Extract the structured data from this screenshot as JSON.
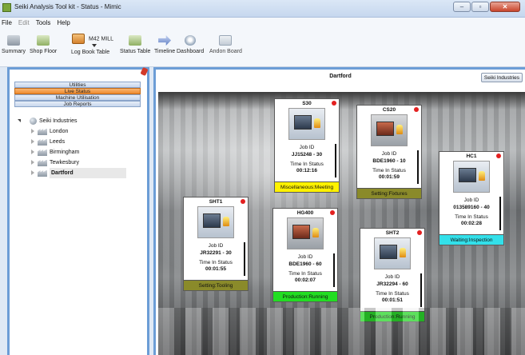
{
  "window": {
    "title": "Seiki Analysis Tool kit - Status - Mimic"
  },
  "menu": [
    "File",
    "Edit",
    "Tools",
    "Help"
  ],
  "toolbar": {
    "summary": "Summary",
    "shop_floor": "Shop Floor",
    "log_book_table": "Log Book Table",
    "machine_selector": "M42 MILL",
    "status_table": "Status Table",
    "timeline": "Timeline",
    "dashboard": "Dashboard",
    "andon_board": "Andon Board"
  },
  "nav": {
    "utilities": "Utilities",
    "live_status": "Live Status",
    "machine_utilisation": "Machine Utilisation",
    "job_reports": "Job Reports"
  },
  "tree": {
    "root": "Seiki Industries",
    "sites": [
      "London",
      "Leeds",
      "Birmingham",
      "Tewkesbury",
      "Dartford"
    ],
    "selected": "Dartford"
  },
  "view": {
    "site_title": "Dartford",
    "company_button": "Seiki Industries"
  },
  "labels": {
    "job_id": "Job ID",
    "time_in_status": "Time In Status"
  },
  "machines": [
    {
      "name": "S30",
      "job_id": "JJ15248 - 30",
      "time": "00:12:16",
      "status": "Miscellaneous:Meeting",
      "status_color": "#fff200"
    },
    {
      "name": "CS20",
      "job_id": "BDE1960 - 10",
      "time": "00:01:59",
      "status": "Setting:Fixtures",
      "status_color": "#8a8a2a"
    },
    {
      "name": "HC1",
      "job_id": "013589160 - 40",
      "time": "00:02:28",
      "status": "Waiting:Inspection",
      "status_color": "#33e0ea"
    },
    {
      "name": "SHT1",
      "job_id": "JR32291 - 30",
      "time": "00:01:55",
      "status": "Setting:Tooling",
      "status_color": "#8a8a2a"
    },
    {
      "name": "HG400",
      "job_id": "BDE1960 - 60",
      "time": "00:02:07",
      "status": "Production:Running",
      "status_color": "#22dd22"
    },
    {
      "name": "SHT2",
      "job_id": "JR32294 - 60",
      "time": "00:01:51",
      "status": "Production:Running",
      "status_color": "#22dd22"
    }
  ],
  "colors": {
    "pane_border": "#6c9dd6",
    "live_status_active": "#ef8a2d",
    "status_dot": "#e32020"
  }
}
